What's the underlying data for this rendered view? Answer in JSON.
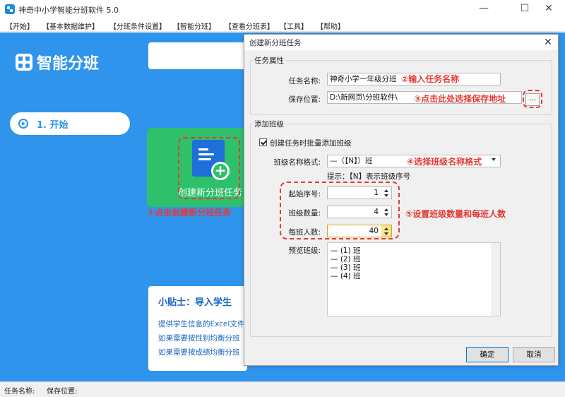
{
  "window": {
    "title": "神奇中小学智能分班软件 5.0",
    "controls": [
      "—",
      "☐",
      "✕"
    ]
  },
  "menu": [
    "【开始】",
    "【基本数据维护】",
    "【分班条件设置】",
    "【智能分班】",
    "【查看分班表】",
    "【工具】",
    "【帮助】"
  ],
  "sidebar": {
    "logo_text": "智能分班",
    "items": [
      {
        "label": "1. 开始"
      }
    ]
  },
  "main": {
    "create_card_label": "创建新分班任务",
    "tips": {
      "title": "小贴士：导入学生",
      "lines": [
        "提供学生信息的Excel文件",
        "如果需要按性别均衡分班",
        "如果需要按成绩均衡分班"
      ]
    }
  },
  "annotations": {
    "a1": "①点击创建新分班任务",
    "a2": "②输入任务名称",
    "a3": "③点击此处选择保存地址",
    "a4": "④选择班级名称格式",
    "a5": "⑤设置班级数量和每班人数"
  },
  "dialog": {
    "title": "创建新分班任务",
    "close": "✕",
    "task_group": {
      "title": "任务属性",
      "name_label": "任务名称:",
      "name_value": "神奇小学一年级分班",
      "path_label": "保存位置:",
      "path_value": "D:\\新网页\\分班软件\\",
      "browse_label": "..."
    },
    "class_group": {
      "title": "添加班级",
      "batch_label": "创建任务时批量添加班级",
      "batch_checked": true,
      "format_label": "班级名称格式:",
      "format_value": "—（【N】）班",
      "hint": "提示：【N】表示班级序号",
      "start_label": "起始序号:",
      "start_value": "1",
      "count_label": "班级数量:",
      "count_value": "4",
      "size_label": "每班人数:",
      "size_value": "40",
      "preview_label": "预览班级:",
      "preview_items": [
        "— (1) 班",
        "— (2) 班",
        "— (3) 班",
        "— (4) 班"
      ]
    },
    "ok_label": "确定",
    "cancel_label": "取消"
  },
  "statusbar": {
    "task_name_label": "任务名称:",
    "save_path_label": "保存位置:"
  },
  "colors": {
    "sidebar": "#2f95ec",
    "accent_green": "#2ec06a",
    "annotation_red": "#e53935"
  }
}
